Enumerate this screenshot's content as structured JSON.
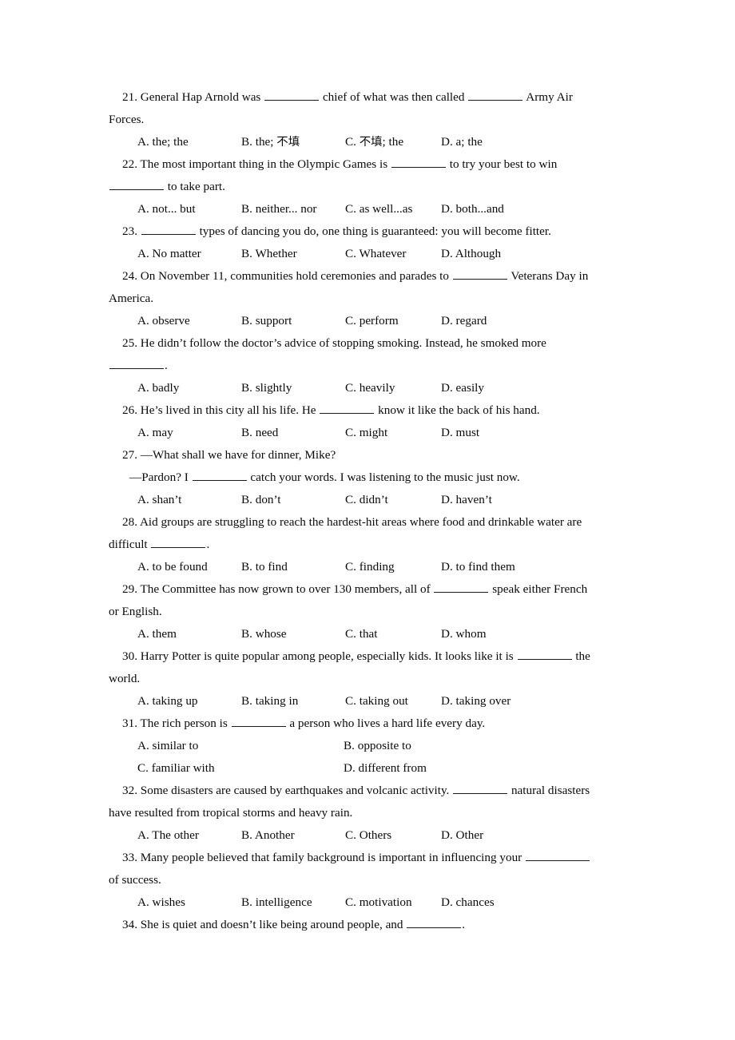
{
  "document": {
    "type": "english-grammar-multiple-choice-worksheet",
    "blank_marker": "_________",
    "questions": [
      {
        "number": "21.",
        "lines": [
          "21. General Hap Arnold was ____ chief of what was then called ____ Army Air",
          "Forces."
        ],
        "stem_parts": [
          "21. General Hap Arnold was ",
          " chief of what was then called ",
          " Army Air Forces."
        ],
        "options": [
          "A. the; the",
          "B. the; 不填",
          "C. 不填; the",
          "D. a; the"
        ],
        "layout": "four-across"
      },
      {
        "number": "22.",
        "stem_parts": [
          "22. The most important thing in the Olympic Games is ",
          " to try your best to win ",
          " to take part."
        ],
        "options": [
          "A. not... but",
          "B. neither... nor",
          "C. as well...as",
          "D. both...and"
        ],
        "layout": "four-across"
      },
      {
        "number": "23.",
        "stem_parts": [
          "23. ",
          " types of dancing you do, one thing is guaranteed: you will become fitter."
        ],
        "options": [
          "A. No matter",
          "B. Whether",
          "C. Whatever",
          "D. Although"
        ],
        "layout": "four-across"
      },
      {
        "number": "24.",
        "stem_parts": [
          "24. On November 11, communities hold ceremonies and parades to ",
          " Veterans Day in America."
        ],
        "options": [
          "A. observe",
          "B. support",
          "C. perform",
          "D. regard"
        ],
        "layout": "four-across"
      },
      {
        "number": "25.",
        "stem_parts": [
          "25. He didn’t follow the doctor’s advice of stopping smoking. Instead, he smoked more ",
          "."
        ],
        "options": [
          "A. badly",
          "B. slightly",
          "C. heavily",
          "D. easily"
        ],
        "layout": "four-across"
      },
      {
        "number": "26.",
        "stem_parts": [
          "26. He’s lived in this city all his life. He ",
          " know it like the back of his hand."
        ],
        "options": [
          "A. may",
          "B. need",
          "C. might",
          "D. must"
        ],
        "layout": "four-across"
      },
      {
        "number": "27.",
        "dialogue": [
          "27. —What shall we have for dinner, Mike?",
          "—Pardon? I "
        ],
        "reply_tail": " catch your words. I was listening to the music just now.",
        "options": [
          "A. shan’t",
          "B. don’t",
          "C. didn’t",
          "D. haven’t"
        ],
        "layout": "four-across"
      },
      {
        "number": "28.",
        "stem_parts": [
          "28. Aid groups are struggling to reach the hardest-hit areas where food and drinkable water are difficult ",
          "."
        ],
        "options": [
          "A. to be found",
          "B. to find",
          "C. finding",
          "D. to find them"
        ],
        "layout": "four-across"
      },
      {
        "number": "29.",
        "stem_parts": [
          "29. The Committee has now grown to over 130 members, all of ",
          " speak either French or English."
        ],
        "options": [
          "A. them",
          "B. whose",
          "C. that",
          "D. whom"
        ],
        "layout": "four-across"
      },
      {
        "number": "30.",
        "stem_parts": [
          "30. Harry Potter is quite popular among people, especially kids. It looks like it is ",
          " the world."
        ],
        "options": [
          "A. taking up",
          "B. taking in",
          "C. taking out",
          "D. taking over"
        ],
        "layout": "four-across"
      },
      {
        "number": "31.",
        "stem_parts": [
          "31. The rich person is ",
          " a person who lives a hard life every day."
        ],
        "options": [
          "A. similar to",
          "B. opposite to",
          "C. familiar with",
          "D. different from"
        ],
        "layout": "two-across"
      },
      {
        "number": "32.",
        "stem_parts": [
          "32. Some disasters are caused by earthquakes and volcanic activity. ",
          " natural disasters have resulted from tropical storms and heavy rain."
        ],
        "options": [
          "A. The other",
          "B. Another",
          "C. Others",
          "D. Other"
        ],
        "layout": "four-across"
      },
      {
        "number": "33.",
        "stem_parts": [
          "33. Many people believed that family background is important in influencing your ",
          " of success."
        ],
        "options": [
          "A. wishes",
          "B. intelligence",
          "C. motivation",
          "D. chances"
        ],
        "layout": "four-across"
      },
      {
        "number": "34.",
        "stem_parts": [
          "34. She is quiet and doesn’t like being around people, and ",
          "."
        ],
        "options": [],
        "layout": "none"
      }
    ]
  },
  "q21": {
    "p1": "21. General Hap Arnold was",
    "p2": "chief of what was then called",
    "p3": "Army Air",
    "p4": "Forces.",
    "a": "A. the; the",
    "b1": "B. the;",
    "b2": "不填",
    "c1": "C.",
    "c2": "不填",
    "c3": "; the",
    "d": "D. a; the"
  },
  "q22": {
    "p1": "22. The most important thing in the Olympic Games is",
    "p2": "to try your best to win",
    "p3": "to take part.",
    "a": "A. not... but",
    "b": "B. neither... nor",
    "c": "C. as well...as",
    "d": "D. both...and"
  },
  "q23": {
    "p1": "23.",
    "p2": "types of dancing you do, one thing is guaranteed: you will become fitter.",
    "a": "A. No matter",
    "b": "B. Whether",
    "c": "C. Whatever",
    "d": "D. Although"
  },
  "q24": {
    "p1": "24. On November 11, communities hold ceremonies and parades to",
    "p2": "Veterans Day in",
    "p3": "America.",
    "a": "A. observe",
    "b": "B. support",
    "c": "C. perform",
    "d": "D. regard"
  },
  "q25": {
    "p1": "25. He didn’t follow the doctor’s advice of stopping smoking. Instead, he smoked more",
    "p2": ".",
    "a": "A. badly",
    "b": "B. slightly",
    "c": "C. heavily",
    "d": "D. easily"
  },
  "q26": {
    "p1": "26. He’s lived in this city all his life. He",
    "p2": "know it like the back of his hand.",
    "a": "A. may",
    "b": "B. need",
    "c": "C. might",
    "d": "D. must"
  },
  "q27": {
    "p1": "27. —What shall we have for dinner, Mike?",
    "p2": "—Pardon? I",
    "p3": "catch your words. I was listening to the music just now.",
    "a": "A. shan’t",
    "b": "B. don’t",
    "c": "C. didn’t",
    "d": "D. haven’t"
  },
  "q28": {
    "p1": "28. Aid groups are struggling to reach the hardest-hit areas where food and drinkable water are",
    "p2": "difficult",
    "p3": ".",
    "a": "A. to be found",
    "b": "B. to find",
    "c": "C. finding",
    "d": "D. to find them"
  },
  "q29": {
    "p1": "29. The Committee has now grown to over 130 members, all of",
    "p2": "speak either French",
    "p3": "or English.",
    "a": "A. them",
    "b": "B. whose",
    "c": "C. that",
    "d": "D. whom"
  },
  "q30": {
    "p1": "30. Harry Potter is quite popular among people, especially kids. It looks like it is",
    "p2": "the",
    "p3": "world.",
    "a": "A. taking up",
    "b": "B. taking in",
    "c": "C. taking out",
    "d": "D. taking over"
  },
  "q31": {
    "p1": "31. The rich person is",
    "p2": "a person who lives a hard life every day.",
    "a": "A. similar to",
    "b": "B. opposite to",
    "c": "C. familiar with",
    "d": "D. different from"
  },
  "q32": {
    "p1": "32. Some disasters are caused by earthquakes and volcanic activity.",
    "p2": "natural disasters",
    "p3": "have resulted from tropical storms and heavy rain.",
    "a": "A. The other",
    "b": "B. Another",
    "c": "C. Others",
    "d": "D. Other"
  },
  "q33": {
    "p1": "33. Many people believed that family background is important in influencing your",
    "p2": "of success.",
    "a": "A. wishes",
    "b": "B. intelligence",
    "c": "C. motivation",
    "d": "D. chances"
  },
  "q34": {
    "p1": "34. She is quiet and doesn’t like being around people, and",
    "p2": "."
  }
}
